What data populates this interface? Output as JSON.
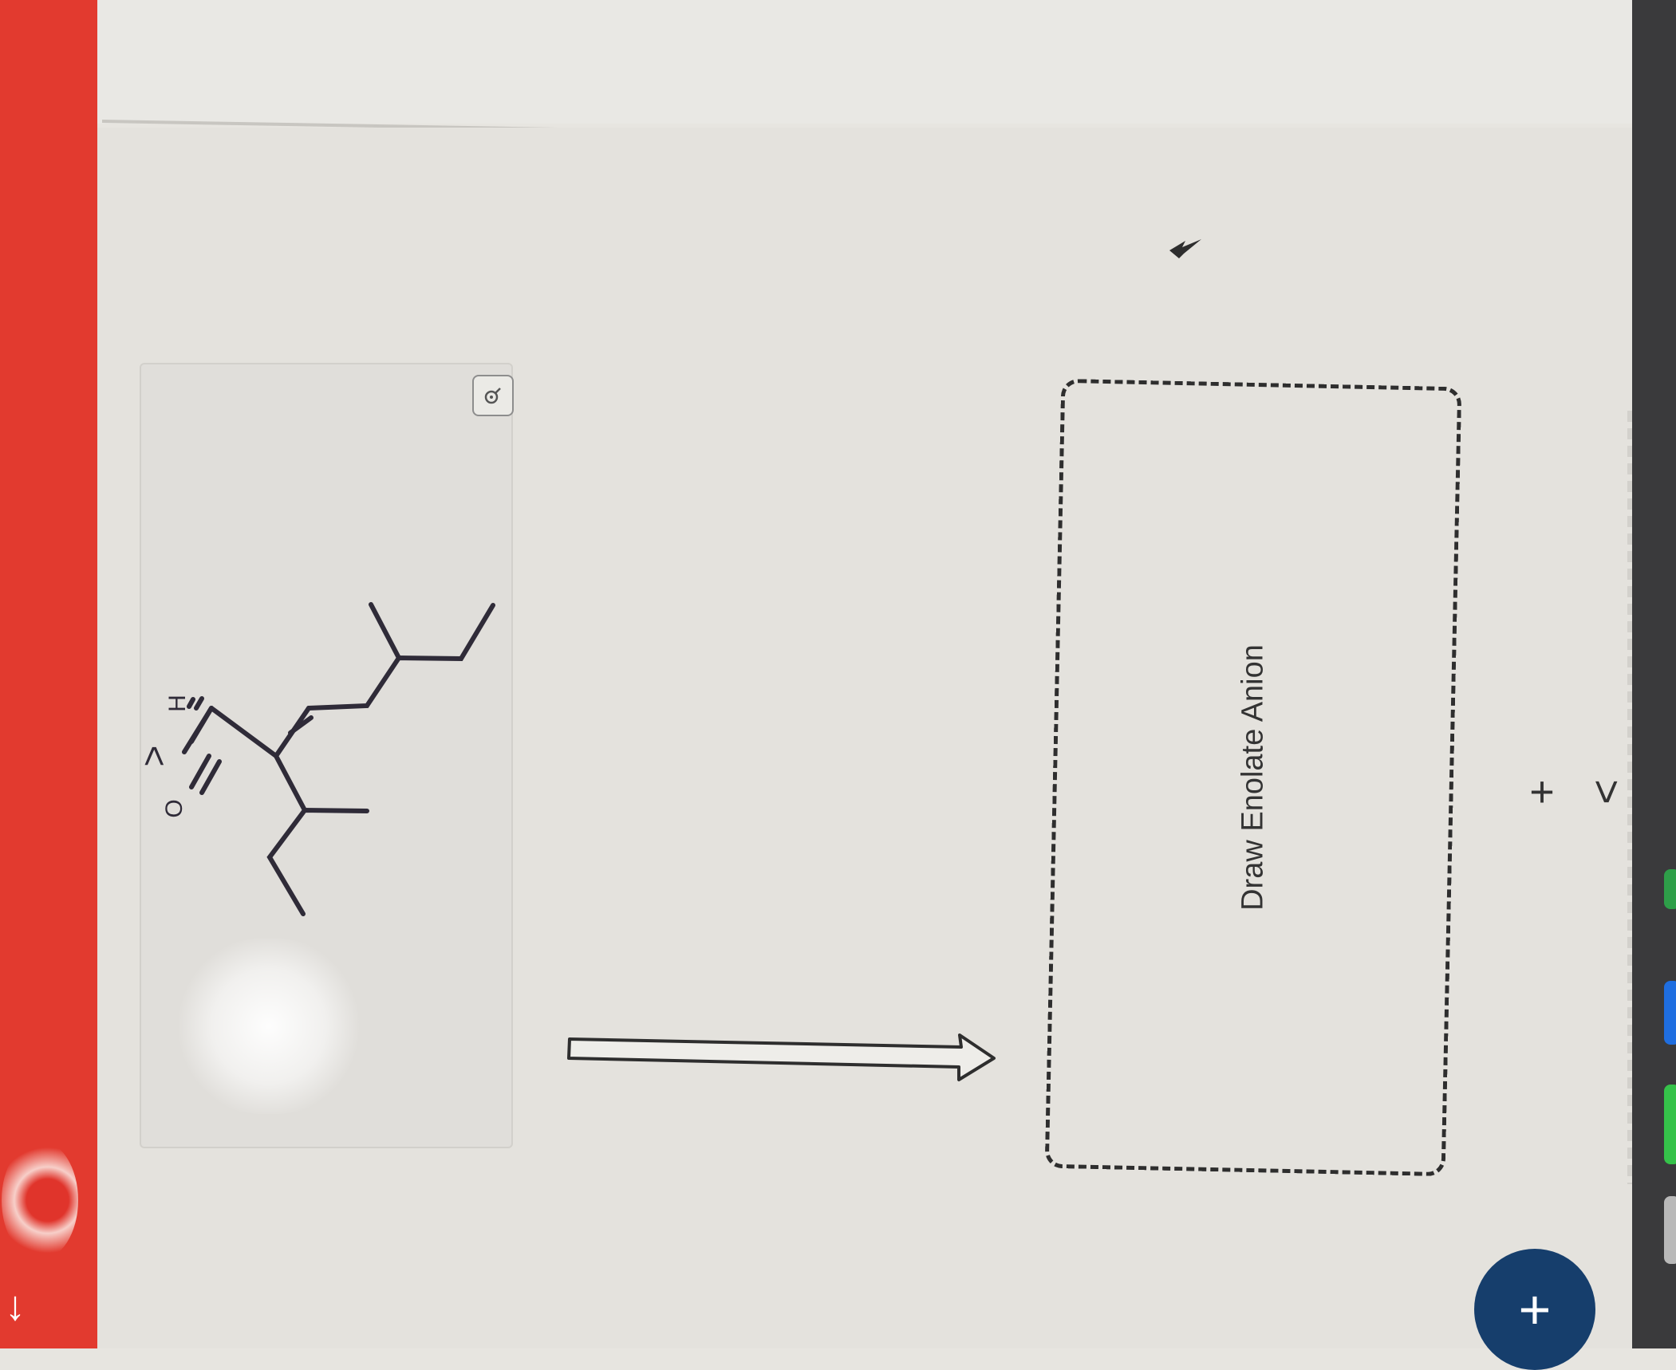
{
  "molecule": {
    "atom_labels": {
      "oxygen": "O",
      "hydrogen": "H"
    }
  },
  "answer_box": {
    "placeholder": "Draw Enolate Anion"
  },
  "controls": {
    "add_label": "+",
    "next_label": ">",
    "fab_label": "+",
    "collapse_label": "<"
  },
  "icons": [
    "zoom-icon",
    "cursor-arrow-icon",
    "down-arrow-icon",
    "reaction-arrow-icon"
  ],
  "colors": {
    "fab": "#163e6c",
    "side_strip": "#e23a2f"
  }
}
